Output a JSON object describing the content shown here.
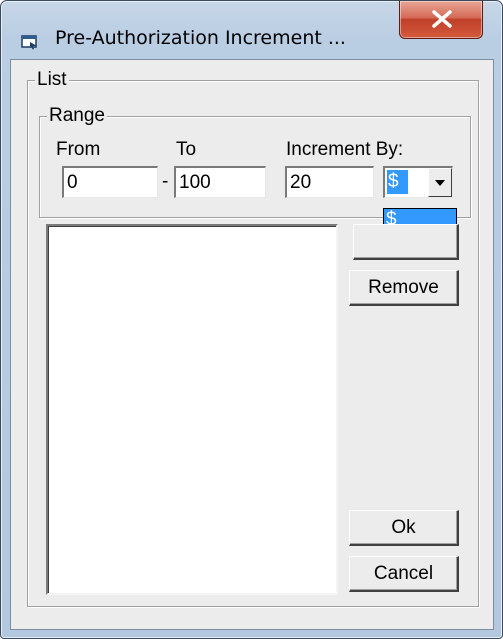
{
  "window": {
    "title": "Pre-Authorization Increment ..."
  },
  "list_group": {
    "label": "List"
  },
  "range_group": {
    "label": "Range",
    "from_label": "From",
    "to_label": "To",
    "increment_label": "Increment By:",
    "separator": "-",
    "from_value": "0",
    "to_value": "100",
    "increment_value": "20"
  },
  "unit_combo": {
    "selected": "$",
    "options": [
      "$",
      "%"
    ]
  },
  "buttons": {
    "remove": "Remove",
    "ok": "Ok",
    "cancel": "Cancel"
  }
}
